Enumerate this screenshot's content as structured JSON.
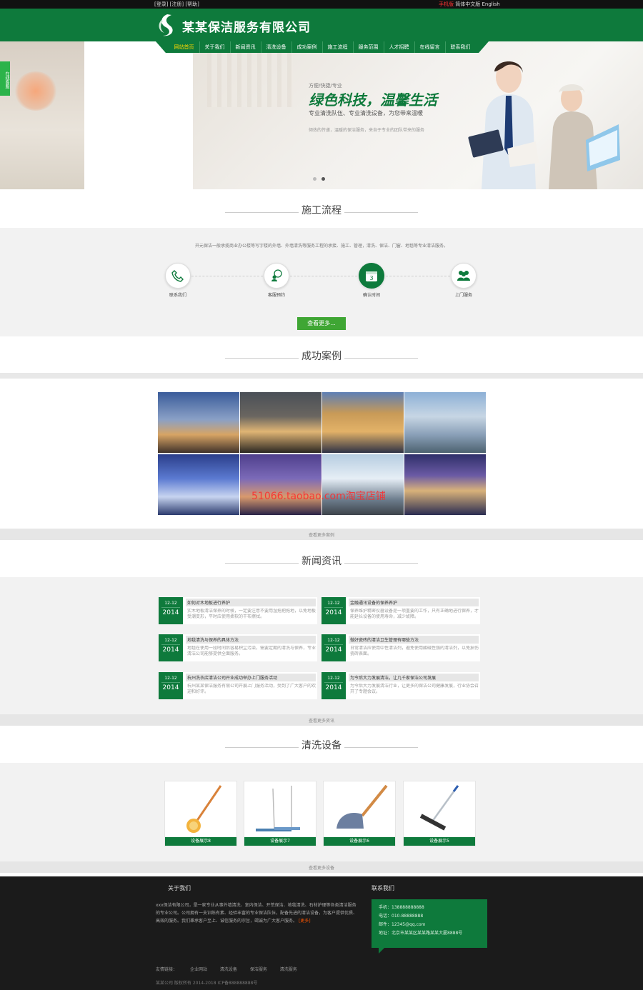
{
  "topbar": {
    "left": "[登录] [注册] [帮助]",
    "phone_label": "手机版",
    "lang": "简体中文版 English"
  },
  "header": {
    "company": "某某保洁服务有限公司"
  },
  "nav": [
    "网站首页",
    "关于我们",
    "新闻资讯",
    "清洗设备",
    "成功案例",
    "施工流程",
    "服务范围",
    "人才招聘",
    "在线留言",
    "联系我们"
  ],
  "side_tab": "在线客服",
  "banner": {
    "small": "方便/快捷/专业",
    "title": "绿色科技，温馨生活",
    "sub": "专业清洗队伍、专业清洗设备，为您带来温暖",
    "desc": "倾热的传递，温暖的保洁服务，来自于专业的团队带来的服务",
    "active_slide": 2,
    "slides": 2
  },
  "process": {
    "title": "施工流程",
    "intro": "开元保洁一般承揽商业办公楼等写字楼的外墙、外墙清洗等服务工程的承接、施工、管理，清洗、保洁、门窗、地毯等专业清洁服务。",
    "steps": [
      {
        "label": "联系我们",
        "icon": "phone-icon"
      },
      {
        "label": "客服预约",
        "icon": "chat-icon"
      },
      {
        "label": "确认时间",
        "icon": "calendar-icon",
        "badge": "3"
      },
      {
        "label": "上门服务",
        "icon": "people-icon"
      }
    ],
    "more": "查看更多..."
  },
  "cases": {
    "title": "成功案例",
    "more": "查看更多案例",
    "watermark": "51066.taobao.com淘宝店铺"
  },
  "news": {
    "title": "新闻资讯",
    "more": "查看更多资讯",
    "items": [
      {
        "md": "12-12",
        "yr": "2014",
        "title": "如何对木地板进行养护",
        "body": "实木地板清洁保养的时候，一定要注意不要用湿拖把拖地，以免地板受潮变形，平时应使用柔软的干布擦拭。"
      },
      {
        "md": "12-12",
        "yr": "2014",
        "title": "金融通讯设备的保养养护",
        "body": "保养维护精密仪器设备是一项重要的工作，只有正确地进行保养，才能延长设备的使用寿命，减少故障。"
      },
      {
        "md": "12-12",
        "yr": "2014",
        "title": "地毯清洗与保养的具体方法",
        "body": "地毯在使用一段时间后容易积尘污染，需要定期的清洗与保养，专业清洁公司能够提供全面服务。"
      },
      {
        "md": "12-12",
        "yr": "2014",
        "title": "做好瓷砖的清洁卫生管理有哪些方法",
        "body": "日常清洁应使用中性清洁剂，避免使用酸碱性强的清洁剂，以免损伤瓷砖表面。"
      },
      {
        "md": "12-12",
        "yr": "2014",
        "title": "杭州洗衣店清洁公司开业成功举办上门服务活动",
        "body": "杭州某某保洁服务有限公司开展上门服务活动，受到了广大客户的欢迎和好评。"
      },
      {
        "md": "12-12",
        "yr": "2014",
        "title": "为今后大力发展清洁，让几千家保洁公司发展",
        "body": "为今后大力发展清洁行业，让更多的保洁公司健康发展，行业协会召开了专题会议。"
      }
    ]
  },
  "equipment": {
    "title": "清洗设备",
    "more": "查看更多设备",
    "items": [
      "设备展示8",
      "设备展示7",
      "设备展示6",
      "设备展示5"
    ]
  },
  "footer": {
    "about_head": "关于我们",
    "about_text": "xxx保洁有限公司，是一家专业从事外墙清洗、室内保洁、开荒保洁、地毯清洗、石材护理等各类清洁服务的专业公司。公司拥有一支训练有素、经验丰富的专业保洁队伍，配备先进的清洁设备，为客户提供优质、高效的服务。我们秉承客户至上、诚信服务的宗旨，竭诚为广大客户服务。",
    "about_more": "[更多]",
    "contact_head": "联系我们",
    "contact": [
      "手机：138888888888",
      "电话：010-88888888",
      "邮件：12345@qq.com",
      "地址：北京市某某区某某路某某大厦8888号"
    ],
    "links_label": "友情链接：",
    "links": [
      "企业网站",
      "清洗设备",
      "保洁服务",
      "清洗服务"
    ],
    "copyright": "某某公司 版权所有 2014-2018 ICP备888888888号"
  }
}
